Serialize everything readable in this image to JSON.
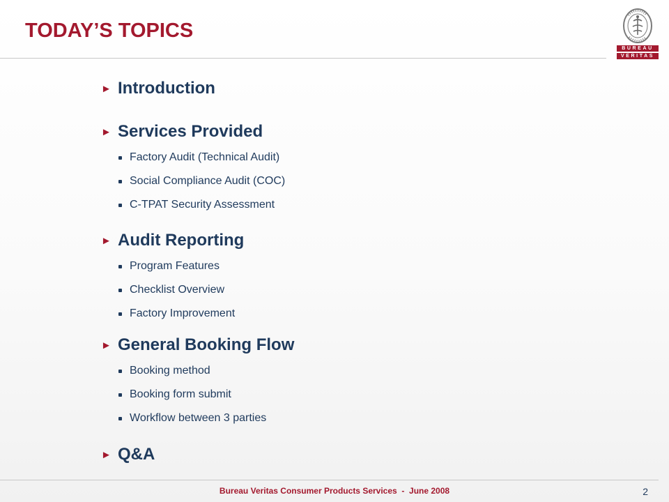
{
  "slide": {
    "title": "TODAY’S TOPICS",
    "topics": [
      {
        "label": "Introduction",
        "items": []
      },
      {
        "label": "Services Provided",
        "items": [
          "Factory Audit (Technical Audit)",
          "Social Compliance Audit (COC)",
          "C-TPAT Security Assessment"
        ]
      },
      {
        "label": "Audit Reporting",
        "items": [
          "Program Features",
          "Checklist Overview",
          "Factory Improvement"
        ]
      },
      {
        "label": "General Booking Flow",
        "items": [
          "Booking method",
          "Booking form submit",
          "Workflow between 3 parties"
        ]
      },
      {
        "label": "Q&A",
        "items": []
      }
    ]
  },
  "logo": {
    "line1": "BUREAU",
    "line2": "VERITAS",
    "seal_text": "BUREAU VERITAS",
    "seal_year": "1828",
    "brand_color": "#a3192e"
  },
  "footer": {
    "text": "Bureau Veritas Consumer Products Services  -  June 2008",
    "page_number": "2"
  },
  "colors": {
    "title": "#a3192e",
    "body_text": "#1f3a5c",
    "arrow": "#a3192e"
  },
  "icons": {
    "topic_marker": "right-triangle-icon",
    "sub_marker": "square-bullet-icon"
  }
}
